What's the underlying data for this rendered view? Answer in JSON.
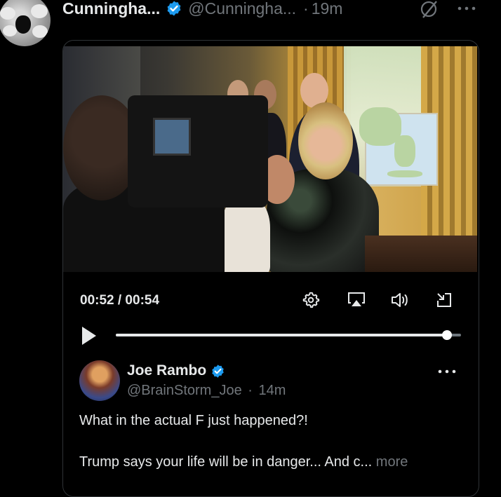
{
  "tweet": {
    "author_name": "Cunningha...",
    "author_handle": "@Cunningha...",
    "separator": "·",
    "timestamp": "19m",
    "avatar_icon": "sheep-avatar",
    "verified_color": "#1d9bf0"
  },
  "media": {
    "time_readout": "00:52 / 00:54",
    "progress_fraction": 0.96,
    "icons": [
      "gear-icon",
      "airplay-icon",
      "volume-icon",
      "minimize-icon",
      "play-icon"
    ]
  },
  "quoted": {
    "name": "Joe Rambo",
    "handle": "@BrainStorm_Joe",
    "separator": "·",
    "timestamp": "14m",
    "line1": "What in the actual F just happened?!",
    "line2": "Trump says your life will be in danger... And c...",
    "more": "more"
  },
  "colors": {
    "background": "#000000",
    "text": "#e7e9ea",
    "muted": "#71767b",
    "accent": "#1d9bf0",
    "border": "#2f3336"
  }
}
